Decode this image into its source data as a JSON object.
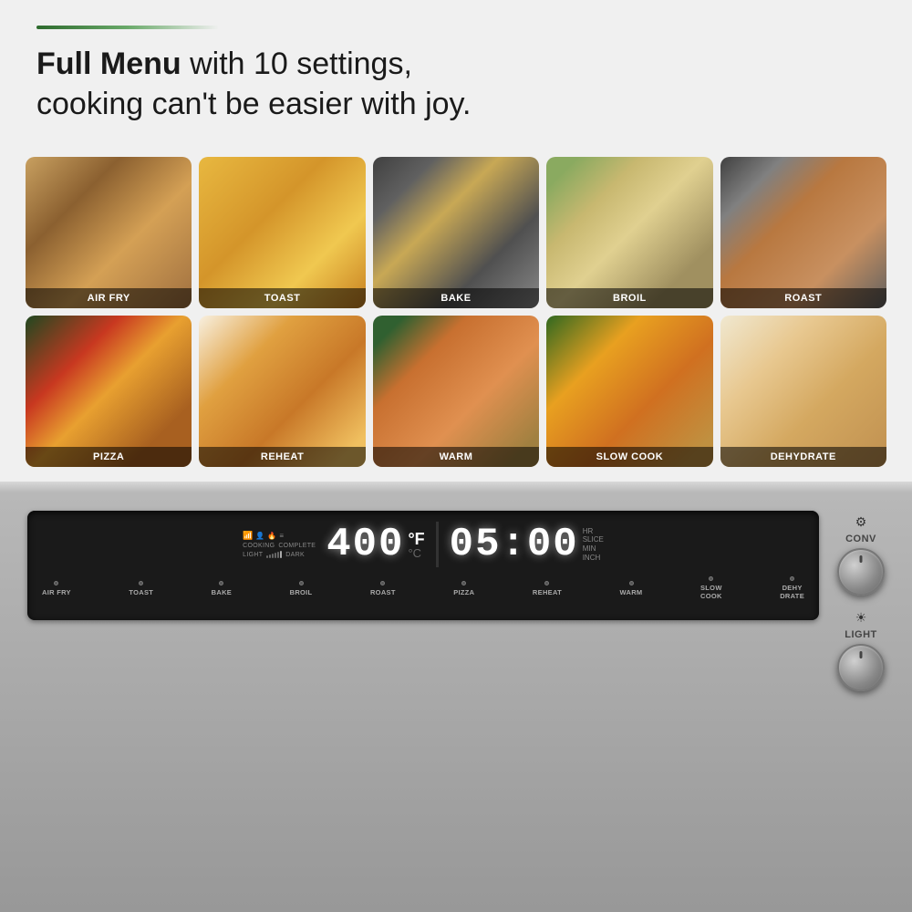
{
  "header": {
    "title_bold": "Full Menu",
    "title_rest": " with 10 settings,\ncooking can't be easier with joy."
  },
  "food_items": [
    {
      "id": "air-fry",
      "label": "AIR FRY",
      "css_class": "food-air-fry"
    },
    {
      "id": "toast",
      "label": "TOAST",
      "css_class": "food-toast"
    },
    {
      "id": "bake",
      "label": "BAKE",
      "css_class": "food-bake"
    },
    {
      "id": "broil",
      "label": "BROIL",
      "css_class": "food-broil"
    },
    {
      "id": "roast",
      "label": "ROAST",
      "css_class": "food-roast"
    },
    {
      "id": "pizza",
      "label": "PIZZA",
      "css_class": "food-pizza"
    },
    {
      "id": "reheat",
      "label": "REHEAT",
      "css_class": "food-reheat"
    },
    {
      "id": "warm",
      "label": "WARM",
      "css_class": "food-warm"
    },
    {
      "id": "slow-cook",
      "label": "SLOW COOK",
      "css_class": "food-slow-cook"
    },
    {
      "id": "dehydrate",
      "label": "DEHYDRATE",
      "css_class": "food-dehydrate"
    }
  ],
  "display": {
    "temperature": "400",
    "temp_unit_f": "°F",
    "temp_unit_c": "°C",
    "time": "05:00",
    "time_hr": "HR",
    "time_min": "MIN",
    "time_slice": "SLICE",
    "time_inch": "INCH",
    "indicator_cooking": "COOKING",
    "indicator_light": "LIGHT",
    "indicator_complete": "COMPLETE",
    "indicator_dark": "DARK"
  },
  "mode_buttons": [
    {
      "id": "air-fry",
      "label": "AIR FRY"
    },
    {
      "id": "toast",
      "label": "TOAST"
    },
    {
      "id": "bake",
      "label": "BAKE"
    },
    {
      "id": "broil",
      "label": "BROIL"
    },
    {
      "id": "roast",
      "label": "ROAST"
    },
    {
      "id": "pizza",
      "label": "PIZZA"
    },
    {
      "id": "reheat",
      "label": "REHEAT"
    },
    {
      "id": "warm",
      "label": "WARM"
    },
    {
      "id": "slow-cook",
      "label": "SLOW\nCOOK"
    },
    {
      "id": "dehydrate",
      "label": "DEHY\nDRATE"
    }
  ],
  "knobs": [
    {
      "id": "conv",
      "label": "CONV",
      "icon": "⚙"
    },
    {
      "id": "light",
      "label": "LIGHT",
      "icon": "☀"
    }
  ]
}
